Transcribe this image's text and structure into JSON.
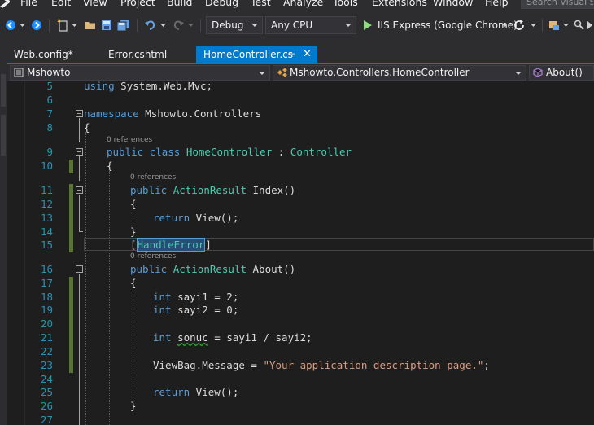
{
  "menu": {
    "items": [
      "File",
      "Edit",
      "View",
      "Project",
      "Build",
      "Debug",
      "Test",
      "Analyze",
      "Tools",
      "Extensions",
      "Window",
      "Help"
    ],
    "search_placeholder": "Search Visual St"
  },
  "toolbar": {
    "configuration": "Debug",
    "platform": "Any CPU",
    "run_target": "IIS Express (Google Chrome)"
  },
  "tabs": [
    {
      "label": "Web.config*",
      "active": false
    },
    {
      "label": "Error.cshtml",
      "active": false
    },
    {
      "label": "HomeController.cs",
      "active": true
    }
  ],
  "tab_icons": {
    "pin": "⊣",
    "close": "✕"
  },
  "navbar": {
    "project": "Mshowto",
    "class": "Mshowto.Controllers.HomeController",
    "member": "About()"
  },
  "editor": {
    "line_numbers": [
      "5",
      "6",
      "7",
      "8",
      "9",
      "10",
      "11",
      "12",
      "13",
      "14",
      "15",
      "16",
      "17",
      "18",
      "19",
      "20",
      "21",
      "22",
      "23",
      "24",
      "25",
      "26",
      "27"
    ],
    "references_label": "0 references",
    "code": {
      "using_kw": "using",
      "using_ns": " System.Web.Mvc;",
      "namespace_kw": "namespace",
      "namespace_name": " Mshowto.Controllers",
      "open_brace": "{",
      "close_brace": "}",
      "public_kw": "public",
      "class_kw": "class",
      "class_name": "HomeController",
      "colon": " : ",
      "base_class": "Controller",
      "action_result": "ActionResult",
      "index_sig": " Index()",
      "return_kw": "return",
      "return_view": " View();",
      "attr_open": "[",
      "attr_name": "HandleError",
      "attr_close": "]",
      "about_sig": " About()",
      "int_kw": "int",
      "sayi1_decl": " sayi1 = 2;",
      "sayi2_decl": " sayi2 = 0;",
      "sonuc_var": "sonuc",
      "sonuc_rest": " = sayi1 / sayi2;",
      "viewbag": "ViewBag.Message = ",
      "viewbag_string": "\"Your application description page.\"",
      "semicolon": ";"
    }
  },
  "colors": {
    "accent": "#007acc",
    "keyword": "#569cd6",
    "type": "#4ec9b0",
    "string": "#d69d85",
    "line_number": "#2b91af",
    "change_bar": "#577430"
  }
}
